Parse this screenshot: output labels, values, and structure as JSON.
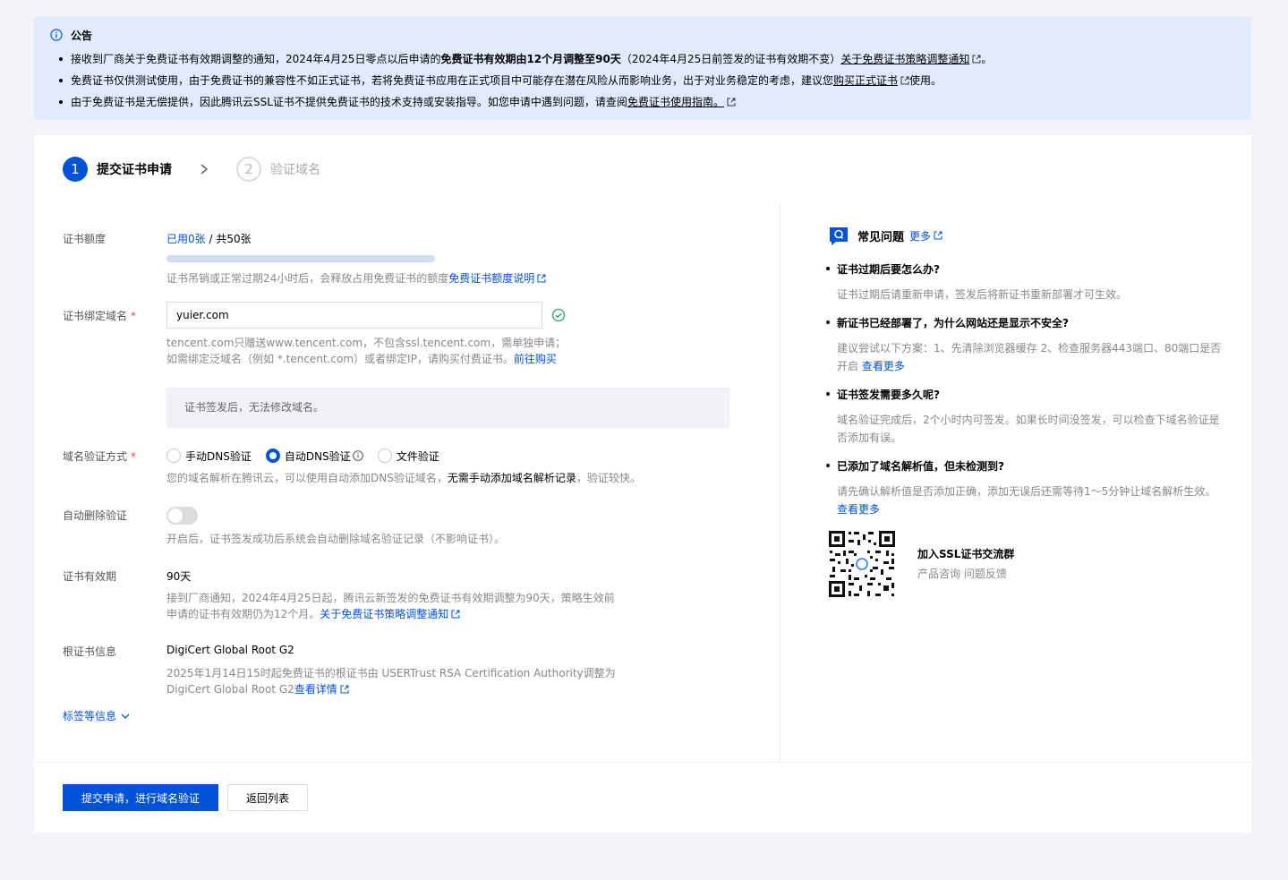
{
  "notice": {
    "title": "公告",
    "item1": {
      "text_a": "接收到厂商关于免费证书有效期调整的通知，2024年4月25日零点以后申请的",
      "bold": "免费证书有效期由12个月调整至90天",
      "text_b": "（2024年4月25日前签发的证书有效期不变）",
      "link": "关于免费证书策略调整通知",
      "tail": "。"
    },
    "item2": {
      "text_a": "免费证书仅供测试使用，由于免费证书的兼容性不如正式证书，若将免费证书应用在正式项目中可能存在潜在风险从而影响业务，出于对业务稳定的考虑，建议您",
      "link": "购买正式证书",
      "tail": "使用。"
    },
    "item3": {
      "text_a": "由于免费证书是无偿提供，因此腾讯云SSL证书不提供免费证书的技术支持或安装指导。如您申请中遇到问题，请查阅",
      "link": "免费证书使用指南。"
    }
  },
  "steps": [
    {
      "num": "1",
      "label": "提交证书申请",
      "state": "active"
    },
    {
      "num": "2",
      "label": "验证域名",
      "state": "inactive"
    }
  ],
  "form": {
    "quota": {
      "label": "证书额度",
      "used": "已用0张",
      "sep": " / ",
      "total": "共50张",
      "used_fraction": 0,
      "help": "证书吊销或正常过期24小时后，会释放占用免费证书的额度",
      "help_link": "免费证书额度说明"
    },
    "domain": {
      "label": "证书绑定域名",
      "required": "*",
      "value": "yuier.com",
      "help1": "tencent.com只赠送www.tencent.com，不包含ssl.tencent.com，需单独申请；",
      "help2": "如需绑定泛域名（例如 *.tencent.com）或者绑定IP，请购买付费证书。",
      "help2_link": "前往购买",
      "notice": "证书签发后，无法修改域名。"
    },
    "verify": {
      "label": "域名验证方式",
      "required": "*",
      "options": [
        "手动DNS验证",
        "自动DNS验证",
        "文件验证"
      ],
      "selected": "自动DNS验证",
      "help_a": "您的域名解析在腾讯云，可以使用自动添加DNS验证域名，",
      "help_bold": "无需手动添加域名解析记录",
      "help_b": "，验证较快。"
    },
    "auto_delete": {
      "label": "自动删除验证",
      "enabled": false,
      "help": "开启后，证书签发成功后系统会自动删除域名验证记录（不影响证书）。"
    },
    "validity": {
      "label": "证书有效期",
      "value": "90天",
      "help1": "接到厂商通知，2024年4月25日起，腾讯云新签发的免费证书有效期调整为90天，策略生效前",
      "help2": "申请的证书有效期仍为12个月。",
      "help2_link": "关于免费证书策略调整通知"
    },
    "root": {
      "label": "根证书信息",
      "value": "DigiCert Global Root G2",
      "help1": "2025年1月14日15时起免费证书的根证书由 USERTrust RSA Certification Authority调整为",
      "help2": "DigiCert Global Root G2",
      "help2_link": "查看详情"
    },
    "tags_link": "标签等信息"
  },
  "faq": {
    "title": "常见问题",
    "more": "更多",
    "items": [
      {
        "q": "证书过期后要怎么办?",
        "a": "证书过期后请重新申请，签发后将新证书重新部署才可生效。",
        "link": ""
      },
      {
        "q": "新证书已经部署了，为什么网站还是显示不安全?",
        "a": "建议尝试以下方案：1、先清除浏览器缓存 2、检查服务器443端口、80端口是否开启",
        "link": "查看更多"
      },
      {
        "q": "证书签发需要多久呢?",
        "a": "域名验证完成后，2个小时内可签发。如果长时间没签发，可以检查下域名验证是否添加有误。",
        "link": ""
      },
      {
        "q": "已添加了域名解析值，但未检测到?",
        "a": "请先确认解析值是否添加正确，添加无误后还需等待1～5分钟让域名解析生效。",
        "link": "查看更多"
      }
    ],
    "group_title": "加入SSL证书交流群",
    "group_sub": "产品咨询 问题反馈"
  },
  "buttons": {
    "submit": "提交申请，进行域名验证",
    "back": "返回列表"
  },
  "colors": {
    "accent": "#0052d9",
    "notice_bg": "#e2ebfd",
    "success": "#2ba471",
    "required": "#e54545"
  }
}
